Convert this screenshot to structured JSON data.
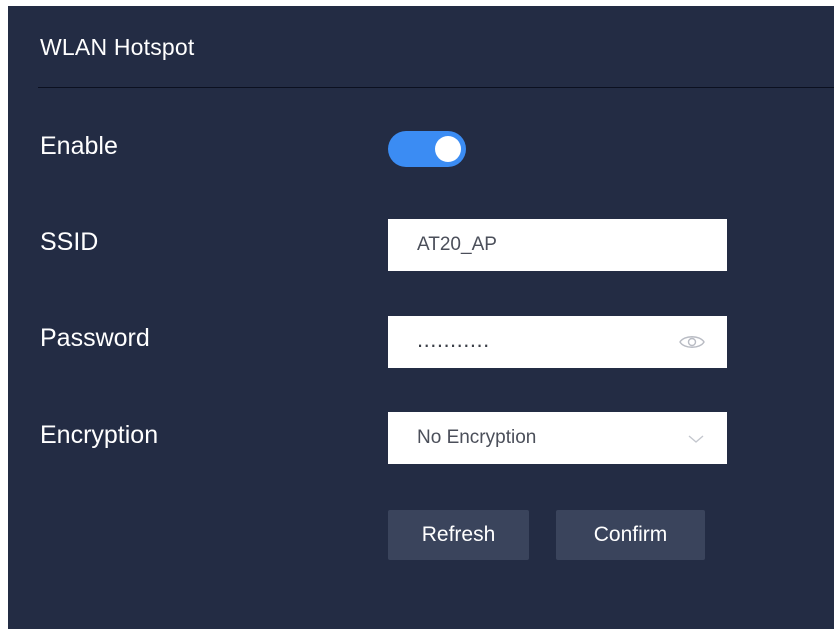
{
  "header": {
    "title": "WLAN Hotspot"
  },
  "form": {
    "enable": {
      "label": "Enable",
      "state": "on"
    },
    "ssid": {
      "label": "SSID",
      "value": "AT20_AP"
    },
    "password": {
      "label": "Password",
      "masked_value": "...........",
      "icon": "eye-icon"
    },
    "encryption": {
      "label": "Encryption",
      "value": "No Encryption",
      "icon": "chevron-down-icon"
    }
  },
  "actions": {
    "refresh_label": "Refresh",
    "confirm_label": "Confirm"
  },
  "colors": {
    "panel_bg": "#232c44",
    "accent": "#3b8cf3",
    "button_bg": "#3a445c",
    "text": "#ffffff"
  }
}
